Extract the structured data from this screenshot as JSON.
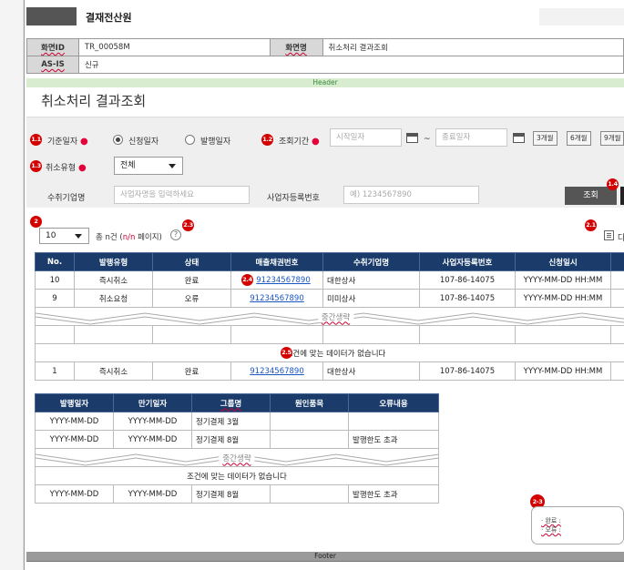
{
  "app": {
    "title": "결재전산원"
  },
  "meta": {
    "screen_id_label": "화면ID",
    "screen_id": "TR_00058M",
    "screen_name_label": "화면명",
    "screen_name": "취소처리 결과조회",
    "asis_label": "AS-IS",
    "asis_value": "신규"
  },
  "header_label": "Header",
  "page_title": "취소처리 결과조회",
  "search": {
    "base_date_label": "기준일자",
    "radio_apply": "신청일자",
    "radio_issue": "발행일자",
    "period_label": "조회기간",
    "start_placeholder": "시작일자",
    "tilde": "~",
    "end_placeholder": "종료일자",
    "period_buttons": [
      "3개월",
      "6개월",
      "9개월"
    ],
    "cancel_type_label": "취소유형",
    "cancel_type_value": "전체",
    "receiver_label": "수취기업명",
    "receiver_placeholder": "사업자명을 입력하세요",
    "bizno_label": "사업자등록번호",
    "bizno_placeholder": "예) 1234567890",
    "search_button": "조회"
  },
  "badges": [
    "1.1",
    "1.2",
    "1.3",
    "1.4",
    "2",
    "2.1",
    "2.3",
    "2.4",
    "2.5",
    "2-3"
  ],
  "results": {
    "page_size": "10",
    "total_prefix": "총 n건 (",
    "total_suffix": " 페이지)",
    "total_pages": "n/n",
    "help_icon": "?",
    "download_fragment": "다"
  },
  "main_table": {
    "columns": [
      "No.",
      "발행유형",
      "상태",
      "매출채권번호",
      "수취기업명",
      "사업자등록번호",
      "신청일시"
    ],
    "rows": [
      [
        "10",
        "즉시취소",
        "완료",
        "91234567890",
        "대한상사",
        "107-86-14075",
        "YYYY-MM-DD HH:MM"
      ],
      [
        "9",
        "취소요청",
        "오류",
        "91234567890",
        "미미상사",
        "107-86-14075",
        "YYYY-MM-DD HH:MM"
      ],
      [
        "1",
        "즉시취소",
        "완료",
        "91234567890",
        "대한상사",
        "107-86-14075",
        "YYYY-MM-DD HH:MM"
      ]
    ],
    "omission": "중간생략",
    "empty_message": "조건에 맞는 데이터가 없습니다"
  },
  "sub_table": {
    "columns": [
      "발행일자",
      "만기일자",
      "그룹명",
      "원인품목",
      "오류내용"
    ],
    "rows": [
      [
        "YYYY-MM-DD",
        "YYYY-MM-DD",
        "정기결제 3월",
        "",
        ""
      ],
      [
        "YYYY-MM-DD",
        "YYYY-MM-DD",
        "정기결제 8월",
        "",
        "발행한도 초과"
      ],
      [
        "YYYY-MM-DD",
        "YYYY-MM-DD",
        "정기결제 8월",
        "",
        "발행한도 초과"
      ]
    ],
    "omission": "중간생략",
    "empty_message": "조건에 맞는 데이터가 없습니다"
  },
  "tooltip": {
    "lines": [
      "· 완료 :",
      "· 오류 :"
    ]
  },
  "footer_label": "Footer",
  "colors": {
    "badge": "#d40000",
    "table_header": "#1b3c6b",
    "link": "#1a56c4",
    "header_bar": "#d8ecd0"
  }
}
